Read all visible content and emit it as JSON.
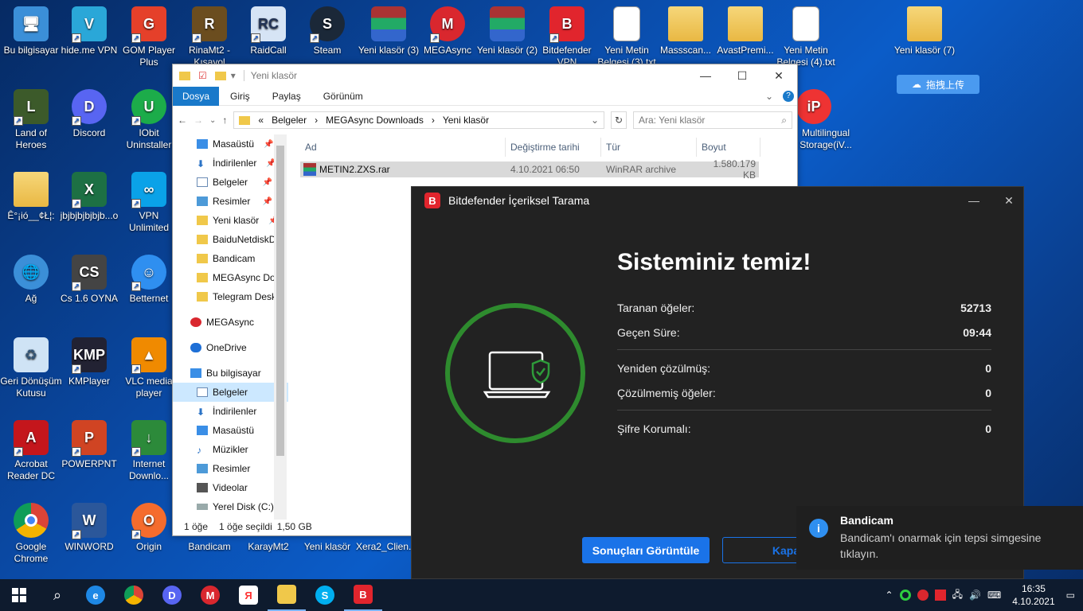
{
  "desktop": {
    "icons": [
      {
        "label": "Bu bilgisayar",
        "icon": "computer-icon"
      },
      {
        "label": "hide.me VPN",
        "icon": "vpn-icon"
      },
      {
        "label": "GOM Player Plus",
        "icon": "gom-player-icon"
      },
      {
        "label": "RinaMt2 - Kısayol",
        "icon": "game-icon"
      },
      {
        "label": "RaidCall",
        "icon": "raidcall-icon"
      },
      {
        "label": "Steam",
        "icon": "steam-icon"
      },
      {
        "label": "Yeni klasör (3)",
        "icon": "winrar-icon"
      },
      {
        "label": "MEGAsync",
        "icon": "mega-icon"
      },
      {
        "label": "Yeni klasör (2)",
        "icon": "winrar-icon"
      },
      {
        "label": "Bitdefender VPN",
        "icon": "bitdefender-vpn-icon"
      },
      {
        "label": "Yeni Metin Belgesi (3).txt",
        "icon": "text-file-icon"
      },
      {
        "label": "Massscan...",
        "icon": "folder-icon"
      },
      {
        "label": "AvastPremi...",
        "icon": "folder-icon"
      },
      {
        "label": "Yeni Metin Belgesi (4).txt",
        "icon": "text-file-icon"
      },
      {
        "label": "Yeni klasör (7)",
        "icon": "folder-icon"
      },
      {
        "label": "Land of Heroes",
        "icon": "game-icon"
      },
      {
        "label": "Discord",
        "icon": "discord-icon"
      },
      {
        "label": "IObit Uninstaller",
        "icon": "iobit-icon"
      },
      {
        "label": "Ê°¡ió__¢Ł¦:",
        "icon": "folder-icon"
      },
      {
        "label": "jbjbjbjbjbjb...o",
        "icon": "excel-icon"
      },
      {
        "label": "VPN Unlimited",
        "icon": "vpn-icon"
      },
      {
        "label": "Ağ",
        "icon": "network-icon"
      },
      {
        "label": "Cs 1.6 OYNA",
        "icon": "game-icon"
      },
      {
        "label": "Betternet",
        "icon": "betternet-icon"
      },
      {
        "label": "Geri Dönüşüm Kutusu",
        "icon": "recycle-bin-icon"
      },
      {
        "label": "KMPlayer",
        "icon": "kmplayer-icon"
      },
      {
        "label": "VLC media player",
        "icon": "vlc-icon"
      },
      {
        "label": "Acrobat Reader DC",
        "icon": "acrobat-icon"
      },
      {
        "label": "POWERPNT",
        "icon": "powerpoint-icon"
      },
      {
        "label": "Internet Downlo...",
        "icon": "idm-icon"
      },
      {
        "label": "Google Chrome",
        "icon": "chrome-icon"
      },
      {
        "label": "WINWORD",
        "icon": "word-icon"
      },
      {
        "label": "Origin",
        "icon": "origin-icon"
      },
      {
        "label": "Bandicam",
        "icon": "bandicam-icon"
      },
      {
        "label": "KarayMt2",
        "icon": "game-icon"
      },
      {
        "label": "Yeni klasör",
        "icon": "folder-icon"
      },
      {
        "label": "Xera2_Clien...",
        "icon": "game-icon"
      },
      {
        "label": "Multilingual Storage(iV...",
        "icon": "app-icon"
      }
    ],
    "baidu_button": "拖拽上传"
  },
  "explorer": {
    "title": "Yeni klasör",
    "tabs": [
      "Dosya",
      "Giriş",
      "Paylaş",
      "Görünüm"
    ],
    "breadcrumb": [
      "Belgeler",
      "MEGAsync Downloads",
      "Yeni klasör"
    ],
    "breadcrumb_prefix": "«",
    "search_placeholder": "Ara: Yeni klasör",
    "nav": [
      {
        "label": "Masaüstü",
        "pinned": true
      },
      {
        "label": "İndirilenler",
        "pinned": true
      },
      {
        "label": "Belgeler",
        "pinned": true
      },
      {
        "label": "Resimler",
        "pinned": true
      },
      {
        "label": "Yeni klasör",
        "pinned": true
      },
      {
        "label": "BaiduNetdiskD"
      },
      {
        "label": "Bandicam"
      },
      {
        "label": "MEGAsync Do"
      },
      {
        "label": "Telegram Desk"
      },
      {
        "label": "MEGAsync"
      },
      {
        "label": "OneDrive"
      },
      {
        "label": "Bu bilgisayar"
      },
      {
        "label": "Belgeler"
      },
      {
        "label": "İndirilenler"
      },
      {
        "label": "Masaüstü"
      },
      {
        "label": "Müzikler"
      },
      {
        "label": "Resimler"
      },
      {
        "label": "Videolar"
      },
      {
        "label": "Yerel Disk (C:)"
      }
    ],
    "columns": [
      "Ad",
      "Değiştirme tarihi",
      "Tür",
      "Boyut"
    ],
    "files": [
      {
        "name": "METIN2.ZXS.rar",
        "date": "4.10.2021 06:50",
        "type": "WinRAR archive",
        "size": "1.580.179 KB"
      }
    ],
    "status": {
      "count": "1 öğe",
      "selected": "1 öğe seçildi",
      "size": "1,50 GB"
    }
  },
  "bitdefender": {
    "title": "Bitdefender İçeriksel Tarama",
    "headline": "Sisteminiz temiz!",
    "rows": [
      {
        "label": "Taranan öğeler:",
        "value": "52713"
      },
      {
        "label": "Geçen Süre:",
        "value": "09:44"
      },
      {
        "label": "Yeniden çözülmüş:",
        "value": "0"
      },
      {
        "label": "Çözülmemiş öğeler:",
        "value": "0"
      },
      {
        "label": "Şifre Korumalı:",
        "value": "0"
      }
    ],
    "primary_button": "Sonuçları Görüntüle",
    "secondary_button": "Kapa",
    "accent": "#1a73e8"
  },
  "toast": {
    "title": "Bandicam",
    "message": "Bandicam'ı onarmak için tepsi simgesine tıklayın."
  },
  "taskbar": {
    "time": "16:35",
    "date": "4.10.2021"
  }
}
